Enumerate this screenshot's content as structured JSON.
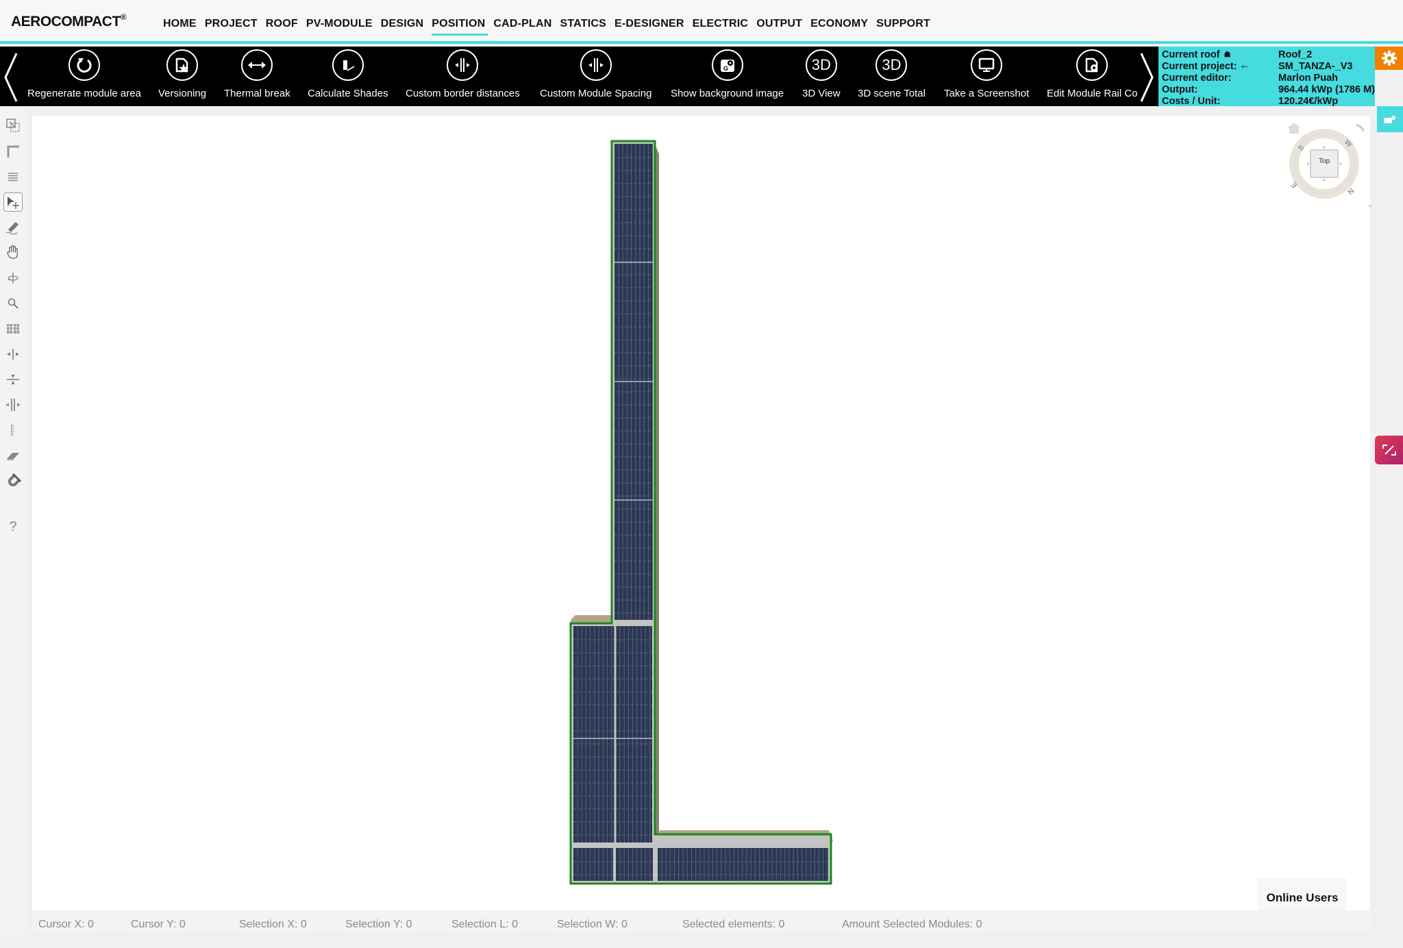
{
  "app": {
    "logo": "AEROCOMPACT",
    "logo_mark": "®"
  },
  "nav": {
    "items": [
      "HOME",
      "PROJECT",
      "ROOF",
      "PV-MODULE",
      "DESIGN",
      "POSITION",
      "CAD-PLAN",
      "STATICS",
      "E-DESIGNER",
      "ELECTRIC",
      "OUTPUT",
      "ECONOMY",
      "SUPPORT"
    ],
    "active": "POSITION"
  },
  "toolbar": {
    "buttons": [
      {
        "label": "Regenerate module area",
        "icon": "refresh-icon"
      },
      {
        "label": "Versioning",
        "icon": "file-star-icon"
      },
      {
        "label": "Thermal break",
        "icon": "double-arrow-icon"
      },
      {
        "label": "Calculate Shades",
        "icon": "shade-icon"
      },
      {
        "label": "Custom border distances",
        "icon": "border-distance-icon"
      },
      {
        "label": "Custom Module Spacing",
        "icon": "module-spacing-icon"
      },
      {
        "label": "Show background image",
        "icon": "map-pin-icon"
      },
      {
        "label": "3D View",
        "icon": "3d-icon",
        "glyph": "3D"
      },
      {
        "label": "3D scene Total",
        "icon": "3d-icon",
        "glyph": "3D"
      },
      {
        "label": "Take a Screenshot",
        "icon": "monitor-icon"
      },
      {
        "label": "Edit Module Rail Co",
        "icon": "file-gear-icon"
      }
    ]
  },
  "info": {
    "rows": [
      {
        "key": "Current roof",
        "icon": "roof-icon",
        "value": "Roof_2"
      },
      {
        "key": "Current project:",
        "icon": "exit-icon",
        "value": "SM_TANZA-_V3"
      },
      {
        "key": "Current editor:",
        "value": "Marlon Puah"
      },
      {
        "key": "Output:",
        "value": "964.44 kWp (1786 M)"
      },
      {
        "key": "Costs / Unit:",
        "value": "120.24€/kWp"
      }
    ]
  },
  "sidebar": {
    "tools": [
      {
        "name": "copy-selection-icon"
      },
      {
        "name": "corner-icon"
      },
      {
        "name": "rows-icon"
      },
      {
        "name": "select-move-icon",
        "active": true
      },
      {
        "name": "pencil-icon"
      },
      {
        "name": "hand-icon"
      },
      {
        "name": "rotate-icon"
      },
      {
        "name": "zoom-icon"
      },
      {
        "name": "grid-icon"
      },
      {
        "name": "split-vertical-icon"
      },
      {
        "name": "split-horizontal-icon"
      },
      {
        "name": "spacing-icon"
      },
      {
        "name": "ruler-icon"
      },
      {
        "name": "eraser-icon"
      },
      {
        "name": "magnet-icon"
      },
      {
        "name": "help-icon",
        "glyph": "?"
      }
    ]
  },
  "compass": {
    "center_label": "Top",
    "directions": [
      "S",
      "W",
      "N",
      "E"
    ]
  },
  "online_users": "Online Users",
  "status": {
    "items": [
      {
        "label": "Cursor X:",
        "value": "0"
      },
      {
        "label": "Cursor Y:",
        "value": "0"
      },
      {
        "label": "Selection X:",
        "value": "0"
      },
      {
        "label": "Selection Y:",
        "value": "0"
      },
      {
        "label": "Selection L:",
        "value": "0"
      },
      {
        "label": "Selection W:",
        "value": "0"
      },
      {
        "label": "Selected elements:",
        "value": "0"
      },
      {
        "label": "Amount Selected Modules:",
        "value": "0"
      }
    ]
  },
  "colors": {
    "accent": "#45dbdf",
    "gear": "#f08000",
    "module": "#2c3852",
    "roof_outline": "#1a8a1a",
    "roof_side": "#b3a388"
  }
}
